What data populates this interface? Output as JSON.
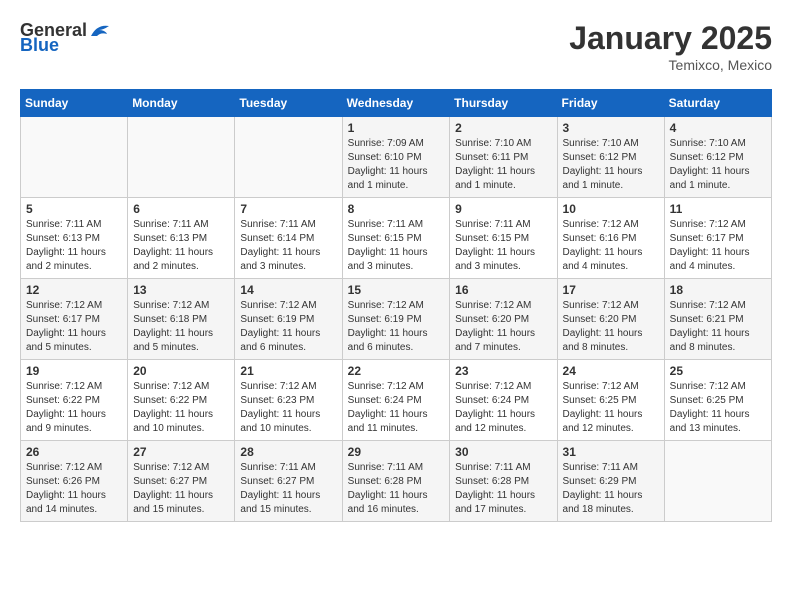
{
  "header": {
    "logo_general": "General",
    "logo_blue": "Blue",
    "month": "January 2025",
    "location": "Temixco, Mexico"
  },
  "weekdays": [
    "Sunday",
    "Monday",
    "Tuesday",
    "Wednesday",
    "Thursday",
    "Friday",
    "Saturday"
  ],
  "weeks": [
    [
      {
        "day": "",
        "info": ""
      },
      {
        "day": "",
        "info": ""
      },
      {
        "day": "",
        "info": ""
      },
      {
        "day": "1",
        "info": "Sunrise: 7:09 AM\nSunset: 6:10 PM\nDaylight: 11 hours and 1 minute."
      },
      {
        "day": "2",
        "info": "Sunrise: 7:10 AM\nSunset: 6:11 PM\nDaylight: 11 hours and 1 minute."
      },
      {
        "day": "3",
        "info": "Sunrise: 7:10 AM\nSunset: 6:12 PM\nDaylight: 11 hours and 1 minute."
      },
      {
        "day": "4",
        "info": "Sunrise: 7:10 AM\nSunset: 6:12 PM\nDaylight: 11 hours and 1 minute."
      }
    ],
    [
      {
        "day": "5",
        "info": "Sunrise: 7:11 AM\nSunset: 6:13 PM\nDaylight: 11 hours and 2 minutes."
      },
      {
        "day": "6",
        "info": "Sunrise: 7:11 AM\nSunset: 6:13 PM\nDaylight: 11 hours and 2 minutes."
      },
      {
        "day": "7",
        "info": "Sunrise: 7:11 AM\nSunset: 6:14 PM\nDaylight: 11 hours and 3 minutes."
      },
      {
        "day": "8",
        "info": "Sunrise: 7:11 AM\nSunset: 6:15 PM\nDaylight: 11 hours and 3 minutes."
      },
      {
        "day": "9",
        "info": "Sunrise: 7:11 AM\nSunset: 6:15 PM\nDaylight: 11 hours and 3 minutes."
      },
      {
        "day": "10",
        "info": "Sunrise: 7:12 AM\nSunset: 6:16 PM\nDaylight: 11 hours and 4 minutes."
      },
      {
        "day": "11",
        "info": "Sunrise: 7:12 AM\nSunset: 6:17 PM\nDaylight: 11 hours and 4 minutes."
      }
    ],
    [
      {
        "day": "12",
        "info": "Sunrise: 7:12 AM\nSunset: 6:17 PM\nDaylight: 11 hours and 5 minutes."
      },
      {
        "day": "13",
        "info": "Sunrise: 7:12 AM\nSunset: 6:18 PM\nDaylight: 11 hours and 5 minutes."
      },
      {
        "day": "14",
        "info": "Sunrise: 7:12 AM\nSunset: 6:19 PM\nDaylight: 11 hours and 6 minutes."
      },
      {
        "day": "15",
        "info": "Sunrise: 7:12 AM\nSunset: 6:19 PM\nDaylight: 11 hours and 6 minutes."
      },
      {
        "day": "16",
        "info": "Sunrise: 7:12 AM\nSunset: 6:20 PM\nDaylight: 11 hours and 7 minutes."
      },
      {
        "day": "17",
        "info": "Sunrise: 7:12 AM\nSunset: 6:20 PM\nDaylight: 11 hours and 8 minutes."
      },
      {
        "day": "18",
        "info": "Sunrise: 7:12 AM\nSunset: 6:21 PM\nDaylight: 11 hours and 8 minutes."
      }
    ],
    [
      {
        "day": "19",
        "info": "Sunrise: 7:12 AM\nSunset: 6:22 PM\nDaylight: 11 hours and 9 minutes."
      },
      {
        "day": "20",
        "info": "Sunrise: 7:12 AM\nSunset: 6:22 PM\nDaylight: 11 hours and 10 minutes."
      },
      {
        "day": "21",
        "info": "Sunrise: 7:12 AM\nSunset: 6:23 PM\nDaylight: 11 hours and 10 minutes."
      },
      {
        "day": "22",
        "info": "Sunrise: 7:12 AM\nSunset: 6:24 PM\nDaylight: 11 hours and 11 minutes."
      },
      {
        "day": "23",
        "info": "Sunrise: 7:12 AM\nSunset: 6:24 PM\nDaylight: 11 hours and 12 minutes."
      },
      {
        "day": "24",
        "info": "Sunrise: 7:12 AM\nSunset: 6:25 PM\nDaylight: 11 hours and 12 minutes."
      },
      {
        "day": "25",
        "info": "Sunrise: 7:12 AM\nSunset: 6:25 PM\nDaylight: 11 hours and 13 minutes."
      }
    ],
    [
      {
        "day": "26",
        "info": "Sunrise: 7:12 AM\nSunset: 6:26 PM\nDaylight: 11 hours and 14 minutes."
      },
      {
        "day": "27",
        "info": "Sunrise: 7:12 AM\nSunset: 6:27 PM\nDaylight: 11 hours and 15 minutes."
      },
      {
        "day": "28",
        "info": "Sunrise: 7:11 AM\nSunset: 6:27 PM\nDaylight: 11 hours and 15 minutes."
      },
      {
        "day": "29",
        "info": "Sunrise: 7:11 AM\nSunset: 6:28 PM\nDaylight: 11 hours and 16 minutes."
      },
      {
        "day": "30",
        "info": "Sunrise: 7:11 AM\nSunset: 6:28 PM\nDaylight: 11 hours and 17 minutes."
      },
      {
        "day": "31",
        "info": "Sunrise: 7:11 AM\nSunset: 6:29 PM\nDaylight: 11 hours and 18 minutes."
      },
      {
        "day": "",
        "info": ""
      }
    ]
  ]
}
